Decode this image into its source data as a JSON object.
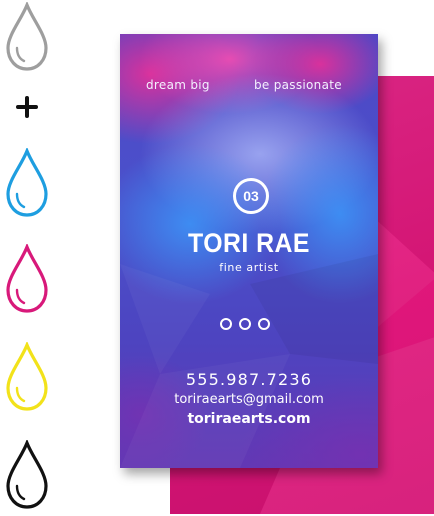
{
  "inks": [
    {
      "name": "drop-gray-icon",
      "color": "#9e9e9e"
    },
    {
      "name": "drop-cyan-icon",
      "color": "#1e9ee0"
    },
    {
      "name": "drop-magenta-icon",
      "color": "#d8197a"
    },
    {
      "name": "drop-yellow-icon",
      "color": "#f2e21a"
    },
    {
      "name": "drop-black-icon",
      "color": "#111111"
    }
  ],
  "colors": {
    "card_front": "#4f46c4",
    "card_back": "#e0177b",
    "wash_pink": "#e0309a"
  },
  "card": {
    "tagline_left": "dream big",
    "tagline_right": "be passionate",
    "number": "03",
    "name": "TORI RAE",
    "role": "fine artist",
    "phone": "555.987.7236",
    "email": "toriraearts@gmail.com",
    "website": "toriraearts.com"
  }
}
